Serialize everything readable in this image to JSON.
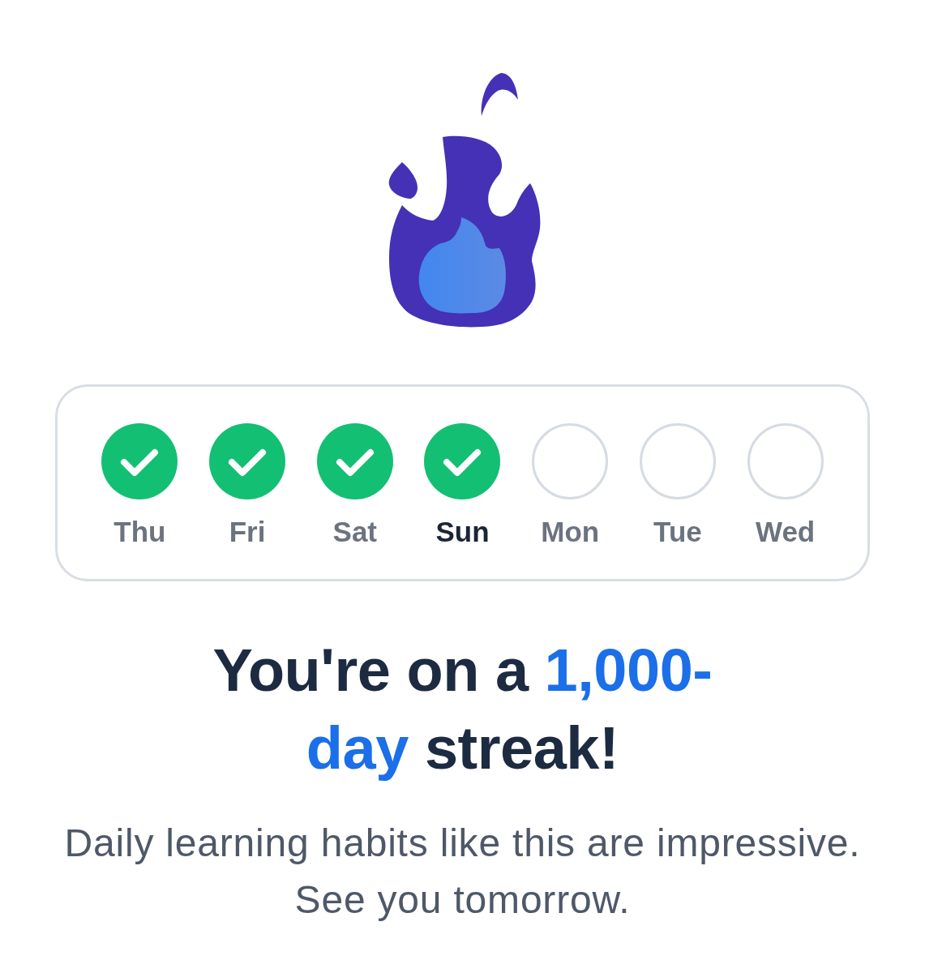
{
  "streak_calendar": {
    "days": [
      {
        "label": "Thu",
        "checked": true,
        "today": false
      },
      {
        "label": "Fri",
        "checked": true,
        "today": false
      },
      {
        "label": "Sat",
        "checked": true,
        "today": false
      },
      {
        "label": "Sun",
        "checked": true,
        "today": true
      },
      {
        "label": "Mon",
        "checked": false,
        "today": false
      },
      {
        "label": "Tue",
        "checked": false,
        "today": false
      },
      {
        "label": "Wed",
        "checked": false,
        "today": false
      }
    ]
  },
  "headline": [
    {
      "text": "You're on a ",
      "highlight": false
    },
    {
      "text": "1,000-day",
      "highlight": true
    },
    {
      "text": " streak!",
      "highlight": false
    }
  ],
  "message": "Daily learning habits like this are impressive. See you tomorrow."
}
